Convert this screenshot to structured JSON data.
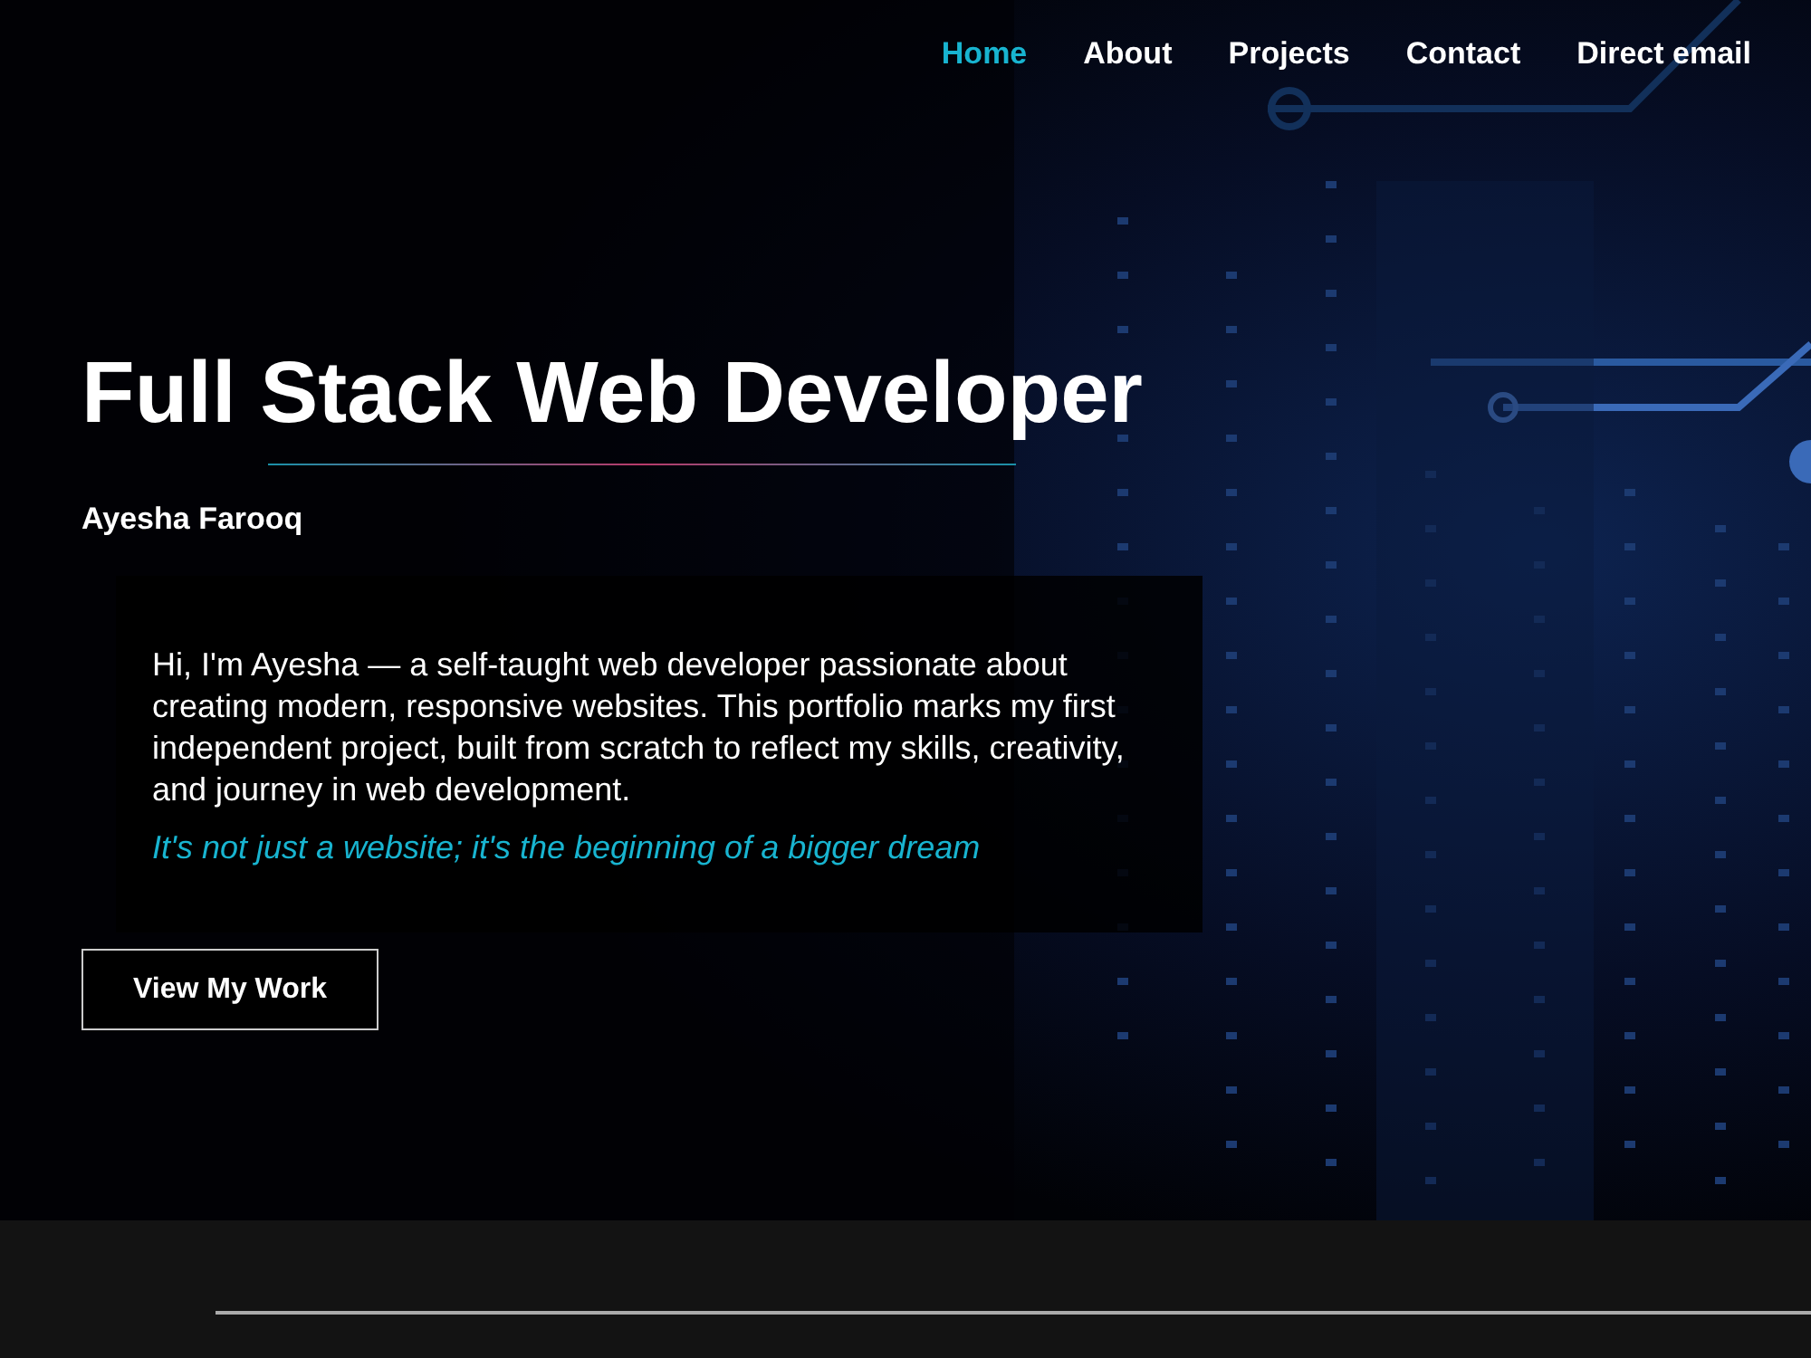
{
  "nav": [
    {
      "label": "Home",
      "selected": true
    },
    {
      "label": "About",
      "selected": false
    },
    {
      "label": "Projects",
      "selected": false
    },
    {
      "label": "Contact",
      "selected": false
    },
    {
      "label": "Direct email",
      "selected": false
    }
  ],
  "hero": {
    "kind": "picture",
    "title": "Full Stack Web Developer",
    "name": "Ayesha Farooq",
    "intro": "Hi, I'm Ayesha — a self-taught web developer passionate about creating modern, responsive websites. This portfolio marks my first independent project, built from scratch to reflect my skills, creativity, and journey in web development.",
    "quote": "It's not just a website; it's the beginning of a bigger dream",
    "button": "View My Work"
  }
}
